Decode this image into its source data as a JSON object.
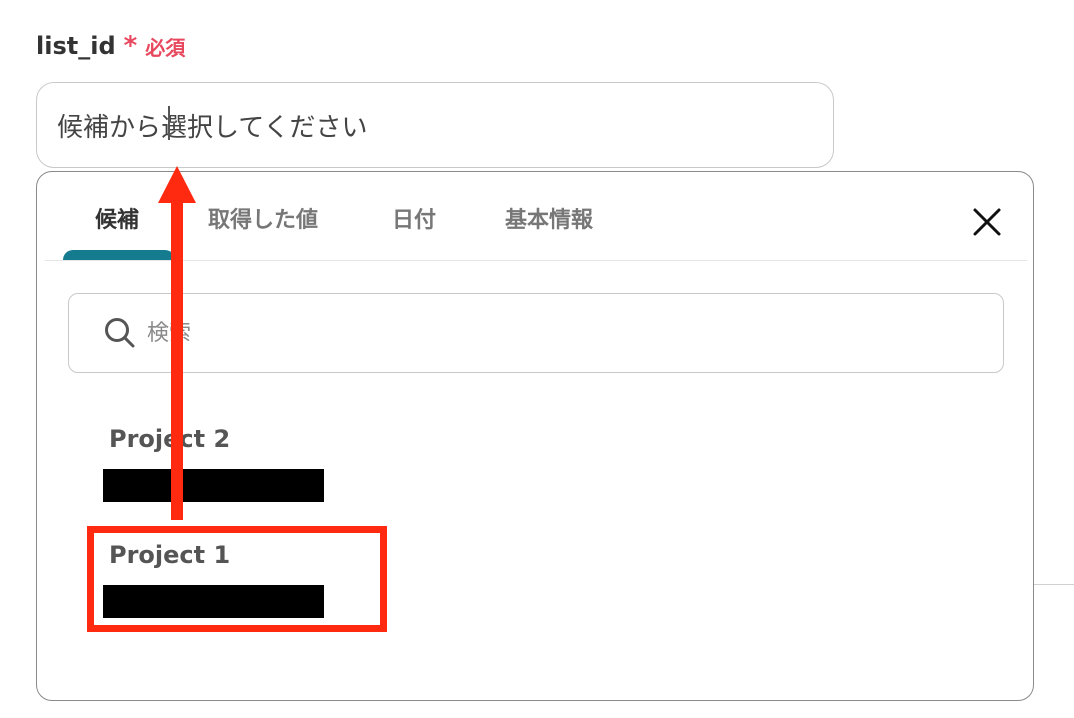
{
  "field": {
    "name": "list_id",
    "required_mark": "*",
    "required_text": "必須",
    "input_value": "候補から選択してください"
  },
  "dropdown": {
    "tabs": [
      {
        "label": "候補",
        "active": true
      },
      {
        "label": "取得した値",
        "active": false
      },
      {
        "label": "日付",
        "active": false
      },
      {
        "label": "基本情報",
        "active": false
      }
    ],
    "close_icon": "close-icon",
    "search_placeholder": "検索",
    "search_icon": "search-icon",
    "options": [
      {
        "title": "Project 2",
        "id": "[redacted]"
      },
      {
        "title": "Project 1",
        "id": "[redacted]",
        "highlighted": true
      }
    ]
  },
  "colors": {
    "required": "#e8485e",
    "tab_indicator": "#157b8f",
    "annotation": "#ff2a10"
  }
}
